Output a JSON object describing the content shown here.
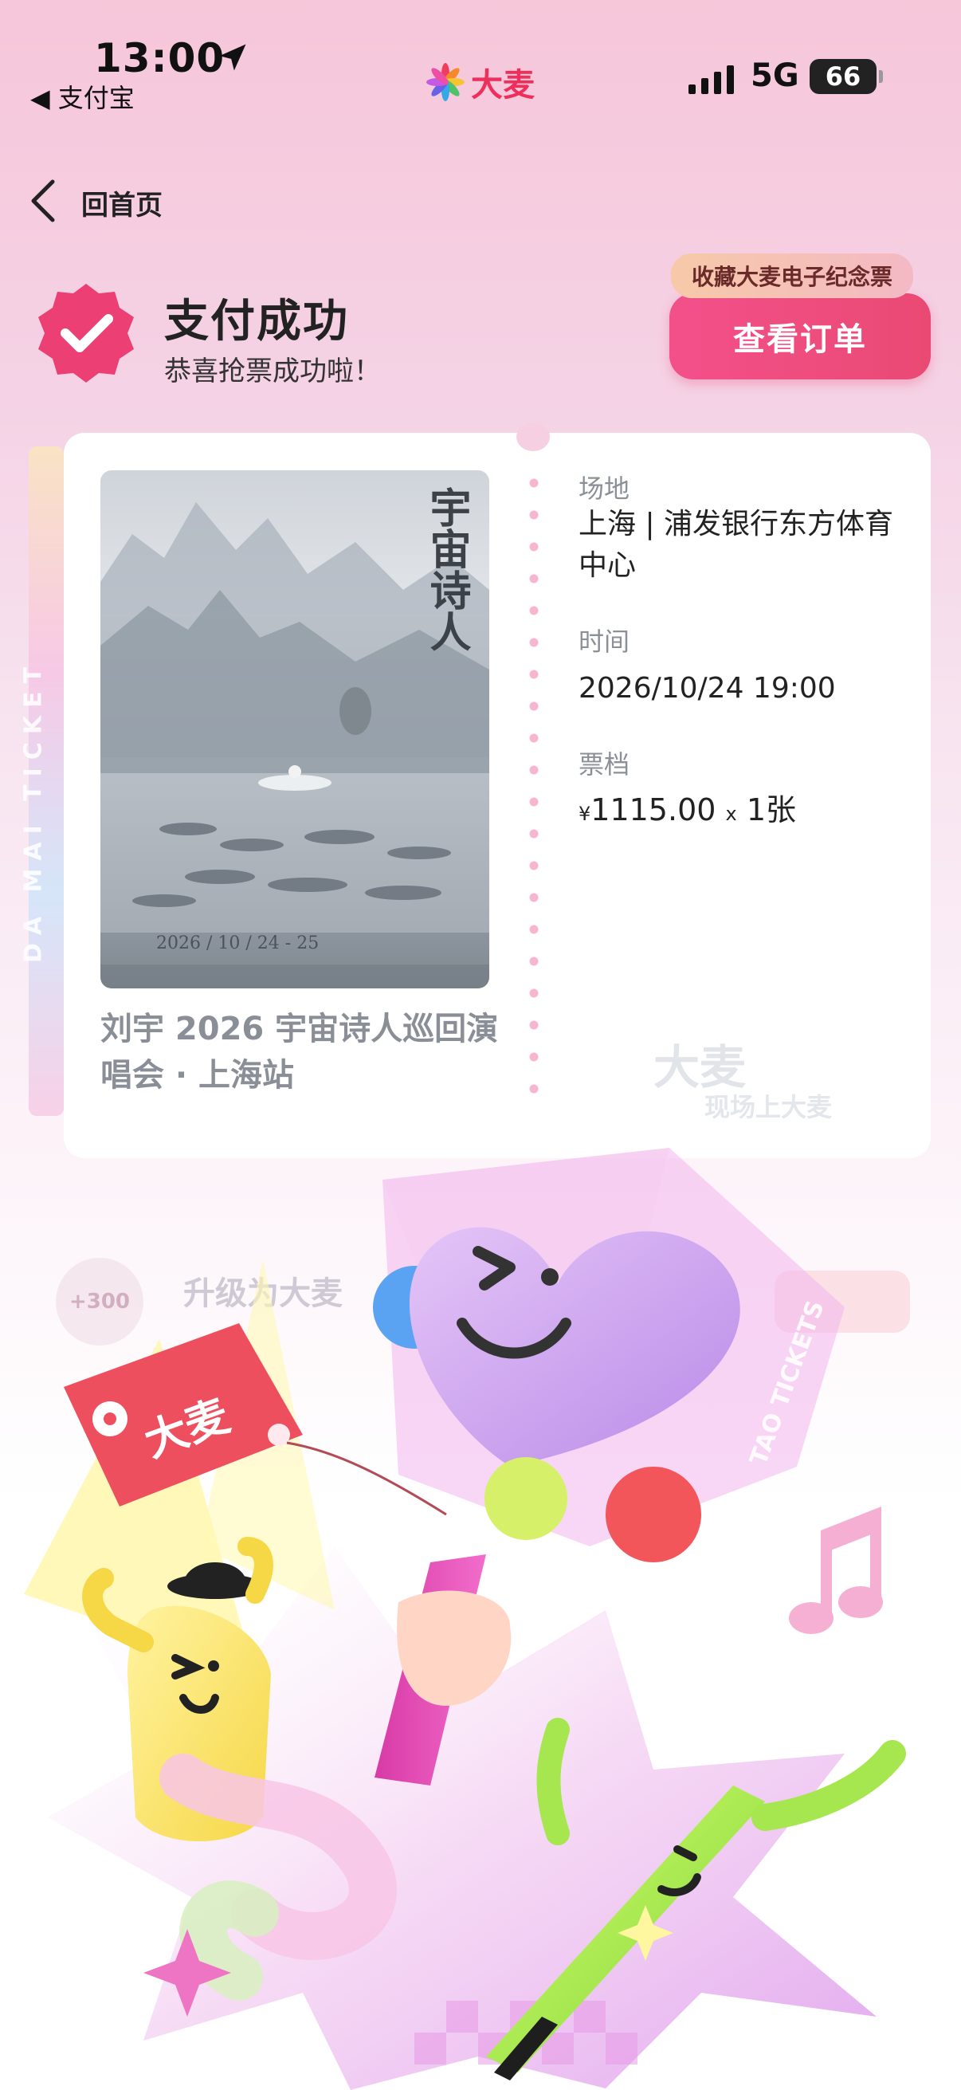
{
  "status_bar": {
    "time": "13:00",
    "back_app": "◀ 支付宝",
    "network": "5G",
    "battery": "66"
  },
  "app": {
    "brand": "大麦"
  },
  "nav": {
    "back_label": "回首页"
  },
  "success": {
    "title": "支付成功",
    "subtitle": "恭喜抢票成功啦！",
    "souvenir_tag": "收藏大麦电子纪念票",
    "order_button": "查看订单"
  },
  "ticket": {
    "rail_text": "DA MAI TICKET",
    "event_name": "刘宇 2026 宇宙诗人巡回演唱会 · 上海站",
    "venue_label": "场地",
    "venue_value": "上海 | 浦发银行东方体育中心",
    "time_label": "时间",
    "time_value": "2026/10/24 19:00",
    "tier_label": "票档",
    "tier_currency": "¥",
    "tier_price": "1115.00",
    "tier_x": "x",
    "tier_qty": "1张",
    "watermark": "大麦",
    "watermark_sub": "现场上大麦"
  },
  "poster": {
    "title_vertical": "宇宙诗人",
    "dates": "2026 / 10 / 24 - 25"
  },
  "upgrade": {
    "coin": "+300",
    "text": "升级为大麦"
  },
  "illustration": {
    "tag_text": "大麦",
    "stick_text": "TAO TICKETS"
  },
  "colors": {
    "accent": "#e94a73",
    "badge": "#ec3f74",
    "tag": "#ee4f5f",
    "heart": "#c9a0ef"
  }
}
